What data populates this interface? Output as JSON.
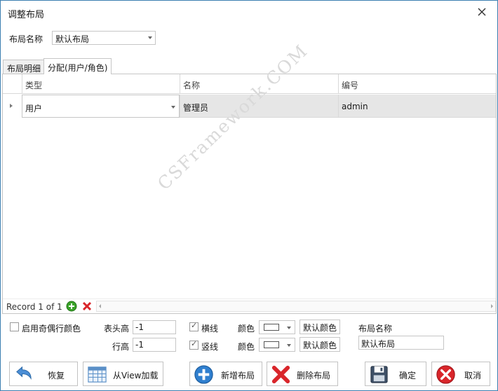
{
  "window": {
    "title": "调整布局",
    "close_icon": "close-icon"
  },
  "layout_selector": {
    "label": "布局名称",
    "value": "默认布局"
  },
  "tabs": [
    {
      "label": "布局明细",
      "active": false
    },
    {
      "label": "分配(用户/角色)",
      "active": true
    }
  ],
  "grid": {
    "columns": [
      "类型",
      "名称",
      "编号"
    ],
    "rows": [
      {
        "type": "用户",
        "name": "管理员",
        "code": "admin"
      }
    ],
    "navigator": {
      "record_text": "Record 1 of 1"
    }
  },
  "watermark": "CSFramework.COM",
  "settings": {
    "odd_even_label": "启用奇偶行颜色",
    "odd_even_checked": false,
    "header_height_label": "表头高",
    "header_height_value": "-1",
    "row_height_label": "行高",
    "row_height_value": "-1",
    "hline_label": "横线",
    "hline_checked": true,
    "vline_label": "竖线",
    "vline_checked": true,
    "color_label_1": "颜色",
    "color_label_2": "颜色",
    "default_color_label_1": "默认颜色",
    "default_color_label_2": "默认颜色",
    "layout_name_label": "布局名称",
    "layout_name_value": "默认布局"
  },
  "buttons": {
    "restore": "恢复",
    "load_from_view": "从View加载",
    "new_layout": "新增布局",
    "delete_layout": "删除布局",
    "ok": "确定",
    "cancel": "取消"
  },
  "colors": {
    "border_accent": "#3c7fb1",
    "row_selected": "#e6e6e6",
    "add_green": "#3aa329",
    "delete_red": "#d9262b",
    "plus_blue": "#2f7fcf"
  }
}
